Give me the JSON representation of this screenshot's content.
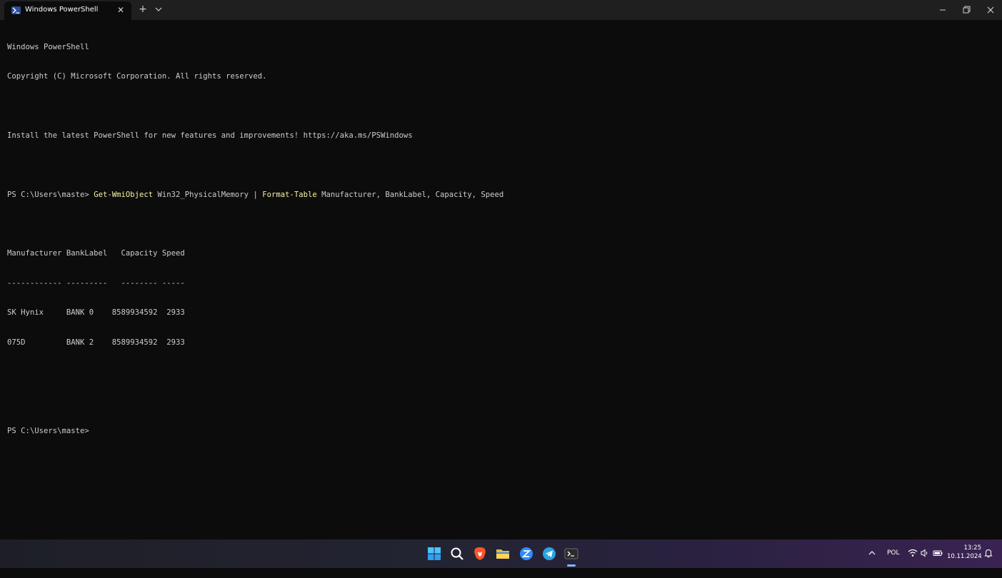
{
  "window": {
    "tab_title": "Windows PowerShell",
    "tab_close": "✕",
    "new_tab": "+"
  },
  "terminal": {
    "banner_line1": "Windows PowerShell",
    "banner_line2": "Copyright (C) Microsoft Corporation. All rights reserved.",
    "install_line": "Install the latest PowerShell for new features and improvements! https://aka.ms/PSWindows",
    "prompt": "PS C:\\Users\\maste> ",
    "command": {
      "cmdlet1": "Get-WmiObject",
      "arg1": " Win32_PhysicalMemory ",
      "pipe": "| ",
      "cmdlet2": "Format-Table",
      "arg2": " Manufacturer, BankLabel, Capacity, Speed"
    },
    "table": {
      "header": "Manufacturer BankLabel   Capacity Speed",
      "separator": "------------ ---------   -------- -----",
      "rows": [
        "SK Hynix     BANK 0    8589934592  2933",
        "075D         BANK 2    8589934592  2933"
      ]
    },
    "final_prompt": "PS C:\\Users\\maste>"
  },
  "taskbar": {
    "icons": [
      "windows-start-icon",
      "search-icon",
      "brave-browser-icon",
      "file-explorer-icon",
      "app-icon",
      "telegram-icon",
      "terminal-icon"
    ],
    "tray": {
      "language": "POL",
      "time": "13:25",
      "date": "10.11.2024"
    }
  },
  "colors": {
    "terminal_bg": "#0c0c0c",
    "terminal_fg": "#cccccc",
    "cmdlet": "#f9f1a5"
  }
}
